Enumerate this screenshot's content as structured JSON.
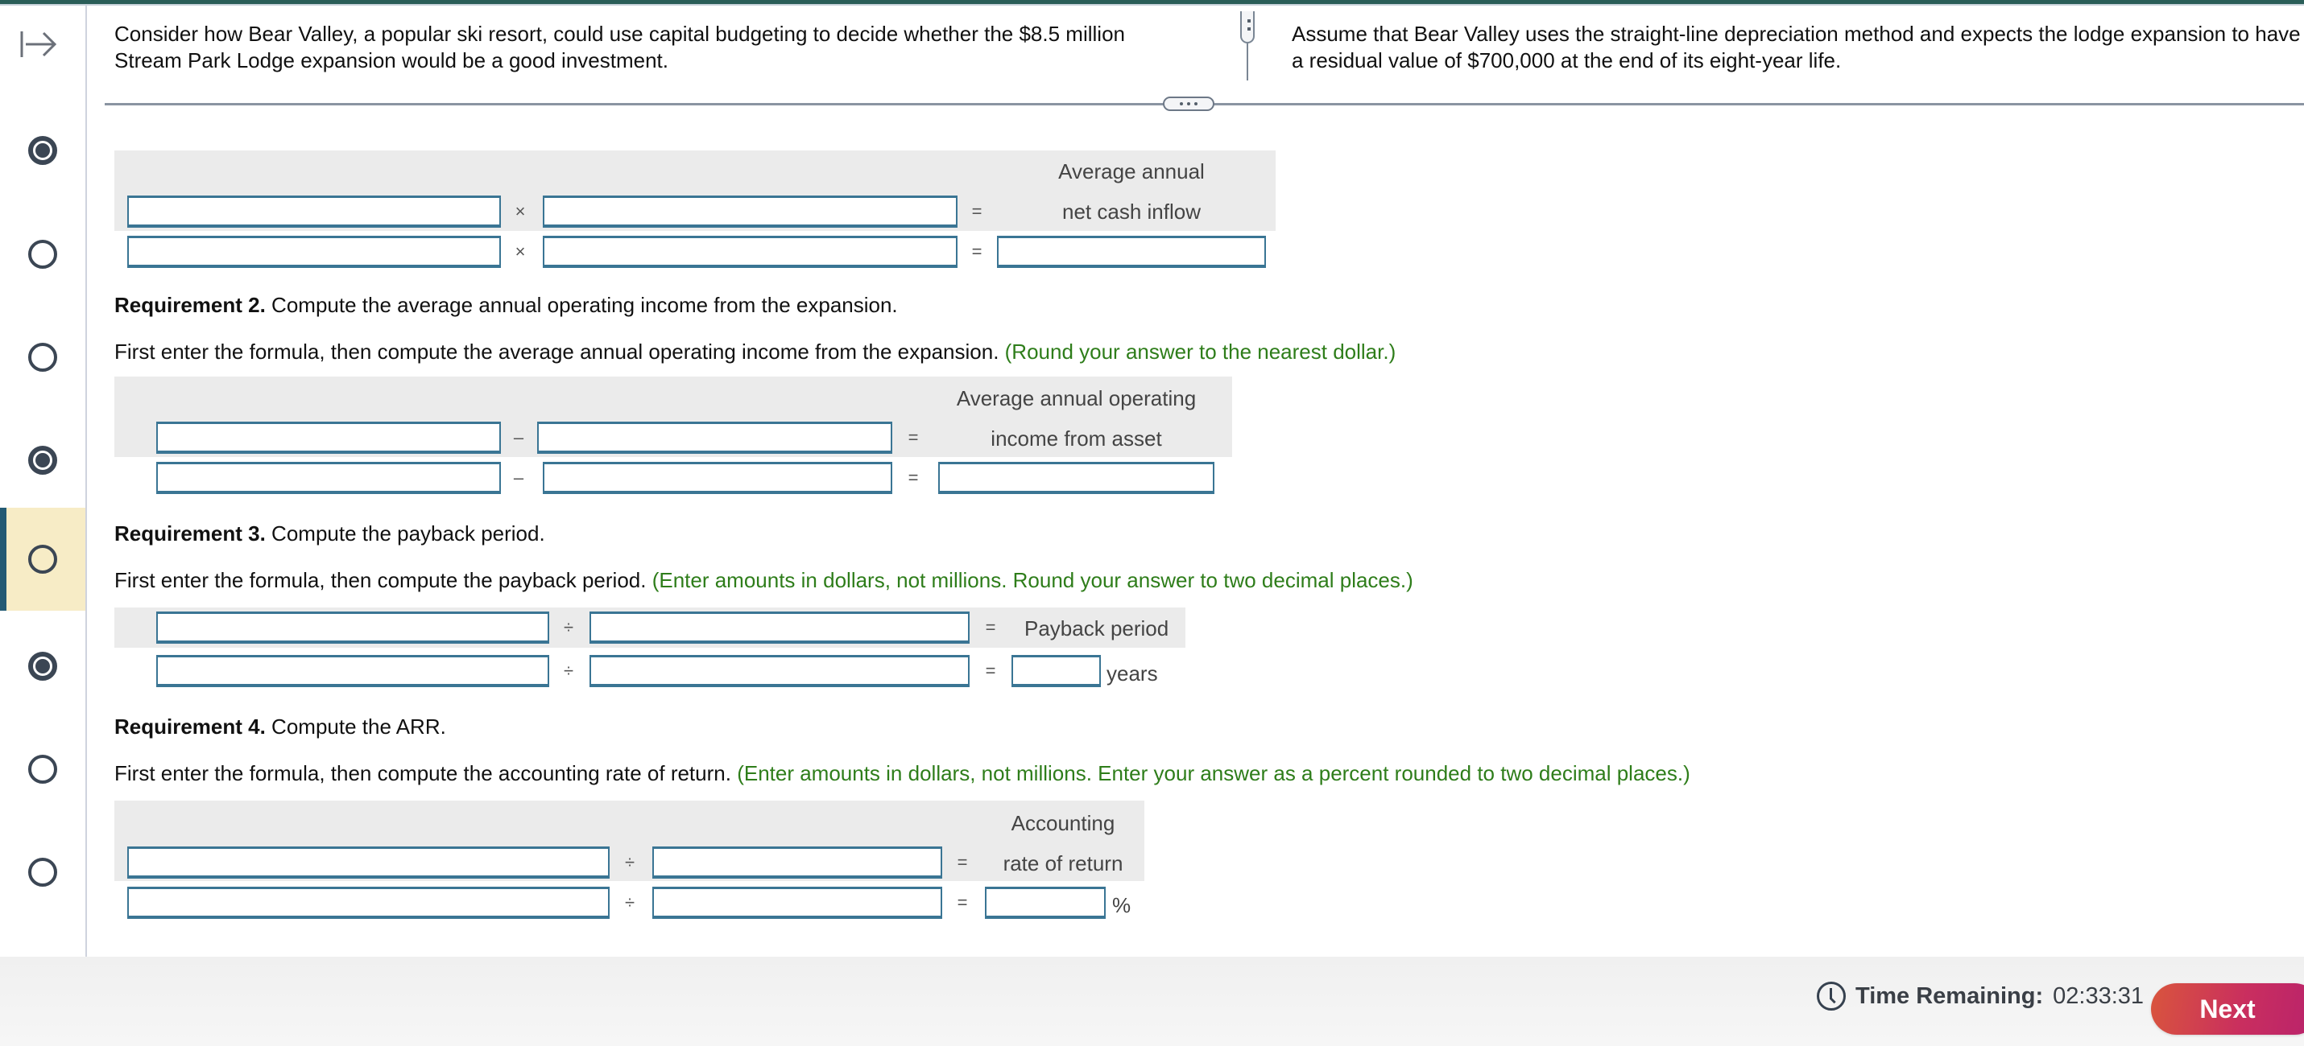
{
  "header": {
    "prompt_left": "Consider how Bear Valley, a popular ski resort, could use capital budgeting to decide whether the $8.5 million Stream Park Lodge expansion would be a good investment.",
    "prompt_right_line1": "Assume that Bear Valley uses the straight-line depreciation method and expects the lodge expansion to have",
    "prompt_right_line2": "a residual value of $700,000 at the end of its eight-year life."
  },
  "rail": {
    "toggle_icon": "collapse-right-arrow-icon",
    "items": [
      {
        "state": "checked"
      },
      {
        "state": "unchecked"
      },
      {
        "state": "unchecked"
      },
      {
        "state": "checked"
      },
      {
        "state": "unchecked",
        "active": true
      },
      {
        "state": "checked"
      },
      {
        "state": "unchecked"
      },
      {
        "state": "unchecked"
      }
    ]
  },
  "req1": {
    "operator": "×",
    "equals": "=",
    "result_label_line1": "Average annual",
    "result_label_line2": "net cash inflow",
    "inputs": {
      "r1a": "",
      "r1b": "",
      "r2a": "",
      "r2b": "",
      "answer": ""
    }
  },
  "req2": {
    "title_bold": "Requirement 2.",
    "title_rest": " Compute the average annual operating income from the expansion.",
    "instruction": "First enter the formula, then compute the average annual operating income from the expansion. ",
    "hint": "(Round your answer to the nearest dollar.)",
    "operator": "–",
    "equals": "=",
    "result_label_line1": "Average annual operating",
    "result_label_line2": "income from asset",
    "inputs": {
      "r1a": "",
      "r1b": "",
      "r2a": "",
      "r2b": "",
      "answer": ""
    }
  },
  "req3": {
    "title_bold": "Requirement 3.",
    "title_rest": " Compute the payback period.",
    "instruction": "First enter the formula, then compute the payback period. ",
    "hint": "(Enter amounts in dollars, not millions. Round your answer to two decimal places.)",
    "operator": "÷",
    "equals": "=",
    "result_label": "Payback period",
    "unit": "years",
    "inputs": {
      "r1a": "",
      "r1b": "",
      "r2a": "",
      "r2b": "",
      "answer": ""
    }
  },
  "req4": {
    "title_bold": "Requirement 4.",
    "title_rest": " Compute the ARR.",
    "instruction": "First enter the formula, then compute the accounting rate of return. ",
    "hint": "(Enter amounts in dollars, not millions. Enter your answer as a percent rounded to two decimal places.)",
    "operator": "÷",
    "equals": "=",
    "result_label_line1": "Accounting",
    "result_label_line2": "rate of return",
    "unit": "%",
    "inputs": {
      "r1a": "",
      "r1b": "",
      "r2a": "",
      "r2b": "",
      "answer": ""
    }
  },
  "footer": {
    "timer_label": "Time Remaining:",
    "timer_value": "02:33:31",
    "next_label": "Next",
    "next_color_start": "#d9553d",
    "next_color_end": "#b8226c"
  },
  "colors": {
    "topbar": "#2a5e58",
    "hint_green": "#2e7d1a",
    "input_border": "#3a7594",
    "active_item_bg": "#f7ecc6",
    "active_item_bar": "#235a74"
  }
}
